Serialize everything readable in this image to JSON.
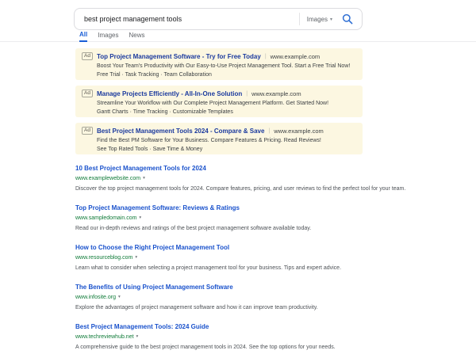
{
  "search_bar": {
    "query": "best project management tools",
    "scope_selector": {
      "label": "Images",
      "chevron": "▾"
    }
  },
  "tabs": {
    "items": [
      {
        "label": "All"
      },
      {
        "label": "Images"
      },
      {
        "label": "News"
      }
    ]
  },
  "ads": {
    "badge_label": "Ad",
    "separator": "|",
    "items": [
      {
        "title": "Top Project Management Software - Try for Free Today",
        "display_url": "www.example.com",
        "description": "Boost Your Team's Productivity with Our Easy-to-Use Project Management Tool. Start a Free Trial Now!",
        "extensions": "Free Trial · Task Tracking · Team Collaboration"
      },
      {
        "title": "Manage Projects Efficiently - All-In-One Solution",
        "display_url": "www.example.com",
        "description": "Streamline Your Workflow with Our Complete Project Management Platform. Get Started Now!",
        "extensions": "Gantt Charts · Time Tracking · Customizable Templates"
      },
      {
        "title": "Best Project Management Tools 2024 - Compare & Save",
        "display_url": "www.example.com",
        "description": "Find the Best PM Software for Your Business. Compare Features & Pricing. Read Reviews!",
        "extensions": "See Top Rated Tools · Save Time & Money"
      }
    ]
  },
  "results": {
    "url_chevron": "▾",
    "items": [
      {
        "title": "10 Best Project Management Tools for 2024",
        "display_url": "www.examplewebsite.com",
        "snippet": "Discover the top project management tools for 2024. Compare features, pricing, and user reviews to find the perfect tool for your team."
      },
      {
        "title": "Top Project Management Software: Reviews & Ratings",
        "display_url": "www.sampledomain.com",
        "snippet": "Read our in-depth reviews and ratings of the best project management software available today."
      },
      {
        "title": "How to Choose the Right Project Management Tool",
        "display_url": "www.resourceblog.com",
        "snippet": "Learn what to consider when selecting a project management tool for your business. Tips and expert advice."
      },
      {
        "title": "The Benefits of Using Project Management Software",
        "display_url": "www.infosite.org",
        "snippet": "Explore the advantages of project management software and how it can improve team productivity."
      },
      {
        "title": "Best Project Management Tools: 2024 Guide",
        "display_url": "www.techreviewhub.net",
        "snippet": "A comprehensive guide to the best project management tools in 2024. See the top options for your needs."
      }
    ]
  },
  "colors": {
    "ad_background": "#fcf7e1",
    "ad_title_blue": "#1b3a9e",
    "organic_title_blue": "#1a52cc",
    "url_green": "#0e7a37",
    "tab_active_blue": "#1a5ed6",
    "search_icon_blue": "#2f6fd4",
    "text_dark": "#3c4043",
    "text_gray": "#5f6368"
  }
}
